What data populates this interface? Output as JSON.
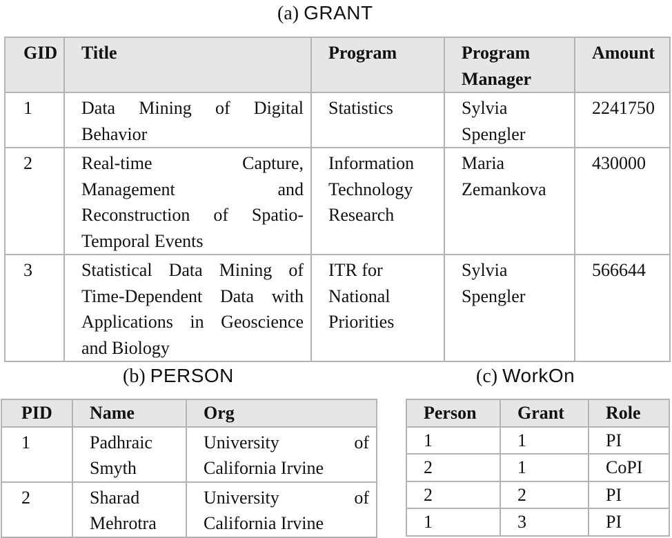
{
  "grant": {
    "caption_label": "(a)",
    "caption_name": "GRANT",
    "headers": [
      "GID",
      "Title",
      "Program",
      "Program Manager",
      "Amount"
    ],
    "rows": [
      [
        "1",
        "Data Mining of Digital Behavior",
        "Statistics",
        "Sylvia Spengler",
        "2241750"
      ],
      [
        "2",
        "Real-time Capture, Management and Reconstruction of Spatio-Temporal Events",
        "Information Technology Research",
        "Maria Zemankova",
        "430000"
      ],
      [
        "3",
        "Statistical Data Mining of Time-Dependent Data with Applications in Geoscience and Biology",
        "ITR for National Priorities",
        "Sylvia Spengler",
        "566644"
      ]
    ]
  },
  "person": {
    "caption_label": "(b)",
    "caption_name": "PERSON",
    "headers": [
      "PID",
      "Name",
      "Org"
    ],
    "rows": [
      [
        "1",
        "Padhraic Smyth",
        "University of California Irvine"
      ],
      [
        "2",
        "Sharad Mehrotra",
        "University of California Irvine"
      ]
    ]
  },
  "workon": {
    "caption_label": "(c)",
    "caption_name": "WorkOn",
    "headers": [
      "Person",
      "Grant",
      "Role"
    ],
    "rows": [
      [
        "1",
        "1",
        "PI"
      ],
      [
        "2",
        "1",
        "CoPI"
      ],
      [
        "2",
        "2",
        "PI"
      ],
      [
        "1",
        "3",
        "PI"
      ]
    ]
  }
}
